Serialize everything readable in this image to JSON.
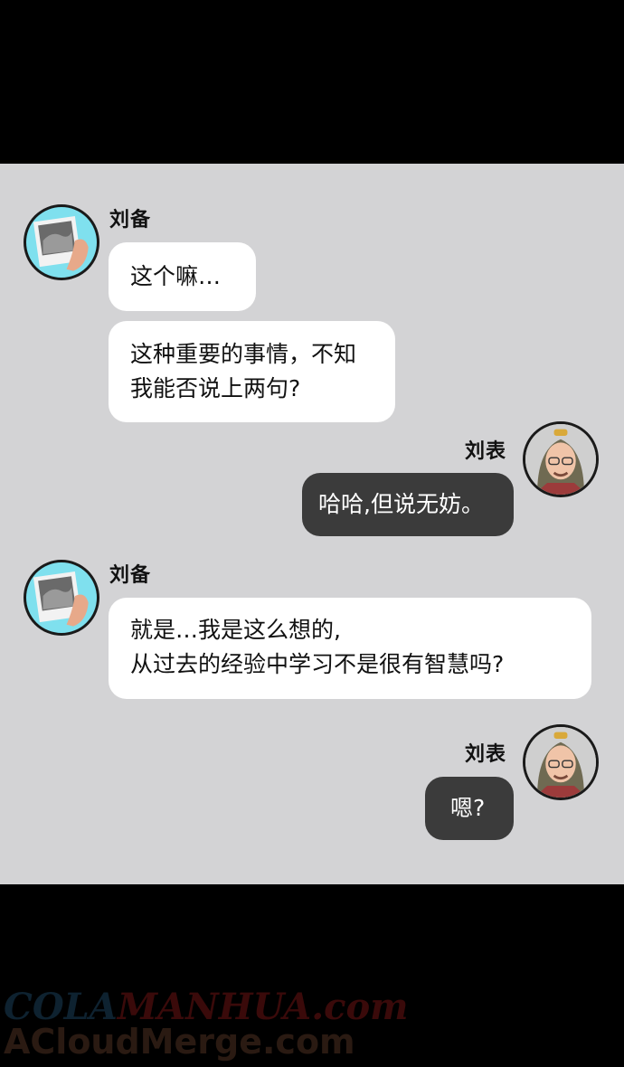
{
  "messages": [
    {
      "sender": "刘备",
      "side": "left",
      "bubbles": [
        {
          "lines": [
            "这个嘛…"
          ]
        },
        {
          "lines": [
            "这种重要的事情，不知",
            "我能否说上两句?"
          ]
        }
      ]
    },
    {
      "sender": "刘表",
      "side": "right",
      "bubbles": [
        {
          "lines": [
            "哈哈,但说无妨。"
          ]
        }
      ]
    },
    {
      "sender": "刘备",
      "side": "left",
      "bubbles": [
        {
          "lines": [
            "就是…我是这么想的,",
            "从过去的经验中学习不是很有智慧吗?"
          ]
        }
      ]
    },
    {
      "sender": "刘表",
      "side": "right",
      "bubbles": [
        {
          "lines": [
            "嗯?"
          ]
        }
      ]
    }
  ],
  "watermark": {
    "line1_part1": "COLA",
    "line1_part2": "MANHUA.com",
    "line2": "ACloudMerge.com"
  },
  "colors": {
    "panel": "#d3d3d5",
    "bubble_left": "#ffffff",
    "bubble_right": "#3b3b3b",
    "liubei_avatar_bg": "#7fe0ee"
  }
}
